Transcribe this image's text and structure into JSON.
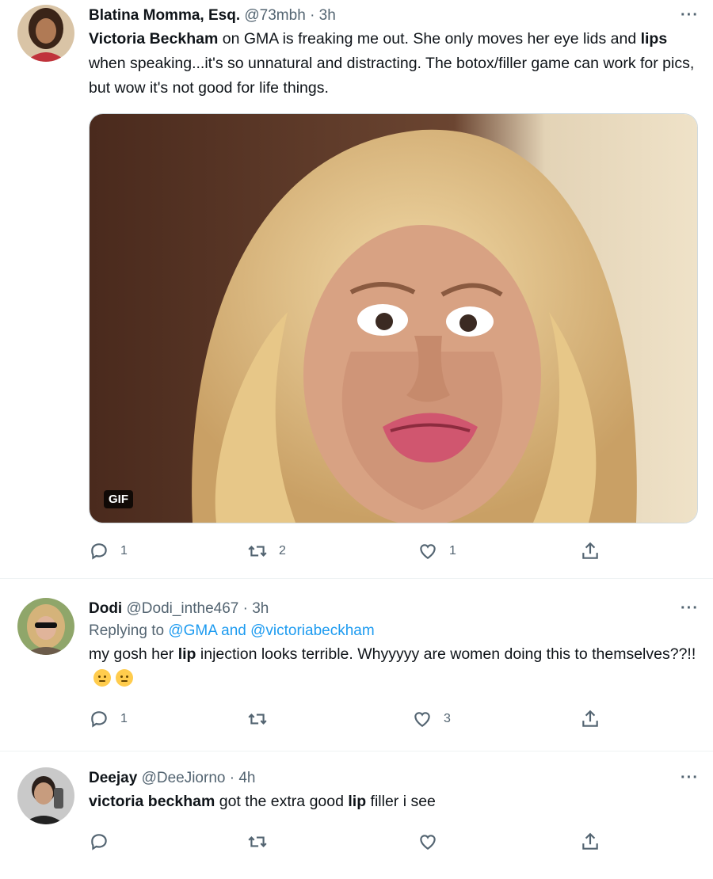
{
  "tweets": [
    {
      "name": "Blatina Momma, Esq.",
      "handle": "@73mbh",
      "time": "· 3h",
      "more": "···",
      "text_parts": {
        "p1_bold": "Victoria Beckham",
        "p2": " on GMA is freaking me out. She only moves her eye lids and ",
        "p3_bold": "lips",
        "p4": " when speaking...it's so unnatural and distracting.  The botox/filler game can work for pics, but wow it's not good for life things."
      },
      "media_badge": "GIF",
      "counts": {
        "reply": "1",
        "retweet": "2",
        "like": "1"
      }
    },
    {
      "name": "Dodi",
      "handle": "@Dodi_inthe467",
      "time": "· 3h",
      "more": "···",
      "replying_prefix": "Replying to ",
      "replying_to": "@GMA and @victoriabeckham",
      "text_parts": {
        "p1": "my gosh her ",
        "p2_bold": "lip",
        "p3": " injection looks terrible. Whyyyyy are women doing this to themselves??!! "
      },
      "counts": {
        "reply": "1",
        "retweet": "",
        "like": "3"
      }
    },
    {
      "name": "Deejay",
      "handle": "@DeeJiorno",
      "time": "· 4h",
      "more": "···",
      "text_parts": {
        "p1_bold": "victoria beckham",
        "p2": " got the extra good ",
        "p3_bold": "lip",
        "p4": " filler i see"
      },
      "counts": {
        "reply": "",
        "retweet": "",
        "like": ""
      }
    }
  ],
  "icons": {
    "reply": "reply-icon",
    "retweet": "retweet-icon",
    "like": "heart-icon",
    "share": "share-icon",
    "more": "more-icon"
  },
  "colors": {
    "link": "#1d9bf0",
    "muted": "#536471",
    "text": "#0f1419",
    "divider": "#eff3f4"
  }
}
